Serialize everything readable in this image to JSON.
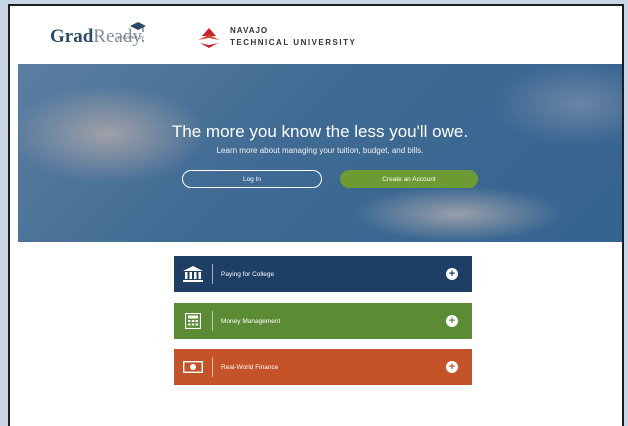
{
  "header": {
    "brand_primary": "Grad",
    "brand_secondary": "Ready.",
    "provided_by": "provided by",
    "partner_line1": "NAVAJO",
    "partner_line2": "TECHNICAL UNIVERSITY"
  },
  "hero": {
    "title": "The more you know the less you'll owe.",
    "subtitle": "Learn more about managing your tuition, budget, and bills.",
    "login_label": "Log In",
    "create_label": "Create an Account"
  },
  "menu": [
    {
      "label": "Paying for College",
      "icon": "bank-icon",
      "color": "#1e3e66"
    },
    {
      "label": "Money Management",
      "icon": "calculator-icon",
      "color": "#5c8b36"
    },
    {
      "label": "Real-World Finance",
      "icon": "money-bill-icon",
      "color": "#c4532a"
    }
  ],
  "colors": {
    "accent_green": "#6d9a33",
    "hero_blue": "#3f6a93"
  }
}
